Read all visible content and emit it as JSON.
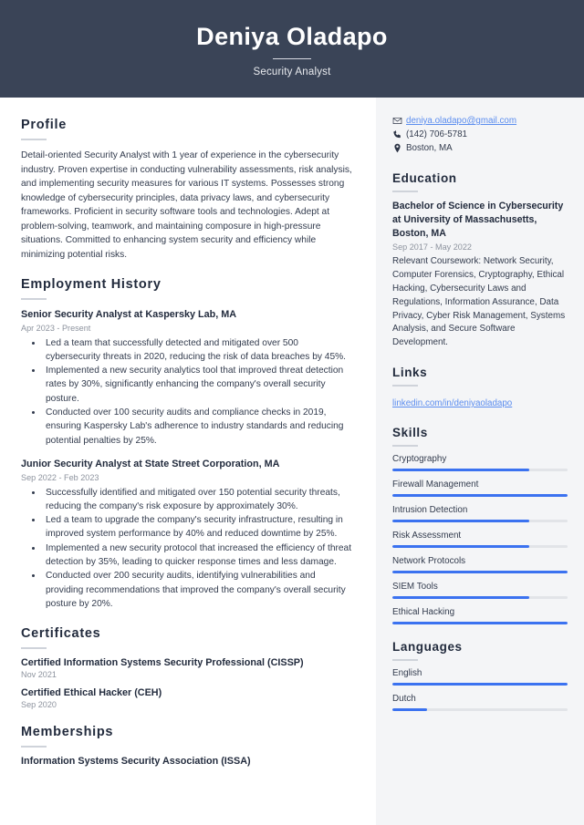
{
  "header": {
    "name": "Deniya Oladapo",
    "subtitle": "Security Analyst"
  },
  "main": {
    "profile": {
      "heading": "Profile",
      "text": "Detail-oriented Security Analyst with 1 year of experience in the cybersecurity industry. Proven expertise in conducting vulnerability assessments, risk analysis, and implementing security measures for various IT systems. Possesses strong knowledge of cybersecurity principles, data privacy laws, and cybersecurity frameworks. Proficient in security software tools and technologies. Adept at problem-solving, teamwork, and maintaining composure in high-pressure situations. Committed to enhancing system security and efficiency while minimizing potential risks."
    },
    "employment": {
      "heading": "Employment History",
      "entries": [
        {
          "title": "Senior Security Analyst at Kaspersky Lab, MA",
          "date": "Apr 2023 - Present",
          "bullets": [
            "Led a team that successfully detected and mitigated over 500 cybersecurity threats in 2020, reducing the risk of data breaches by 45%.",
            "Implemented a new security analytics tool that improved threat detection rates by 30%, significantly enhancing the company's overall security posture.",
            "Conducted over 100 security audits and compliance checks in 2019, ensuring Kaspersky Lab's adherence to industry standards and reducing potential penalties by 25%."
          ]
        },
        {
          "title": "Junior Security Analyst at State Street Corporation, MA",
          "date": "Sep 2022 - Feb 2023",
          "bullets": [
            "Successfully identified and mitigated over 150 potential security threats, reducing the company's risk exposure by approximately 30%.",
            "Led a team to upgrade the company's security infrastructure, resulting in improved system performance by 40% and reduced downtime by 25%.",
            "Implemented a new security protocol that increased the efficiency of threat detection by 35%, leading to quicker response times and less damage.",
            "Conducted over 200 security audits, identifying vulnerabilities and providing recommendations that improved the company's overall security posture by 20%."
          ]
        }
      ]
    },
    "certificates": {
      "heading": "Certificates",
      "items": [
        {
          "title": "Certified Information Systems Security Professional (CISSP)",
          "date": "Nov 2021"
        },
        {
          "title": "Certified Ethical Hacker (CEH)",
          "date": "Sep 2020"
        }
      ]
    },
    "memberships": {
      "heading": "Memberships",
      "items": [
        {
          "title": "Information Systems Security Association (ISSA)"
        }
      ]
    }
  },
  "sidebar": {
    "contact": [
      {
        "icon": "email-icon",
        "value": "deniya.oladapo@gmail.com",
        "link": true
      },
      {
        "icon": "phone-icon",
        "value": "(142) 706-5781",
        "link": false
      },
      {
        "icon": "location-icon",
        "value": "Boston, MA",
        "link": false
      }
    ],
    "education": {
      "heading": "Education",
      "title": "Bachelor of Science in Cybersecurity at University of Massachusetts, Boston, MA",
      "date": "Sep 2017 - May 2022",
      "description": "Relevant Coursework: Network Security, Computer Forensics, Cryptography, Ethical Hacking, Cybersecurity Laws and Regulations, Information Assurance, Data Privacy, Cyber Risk Management, Systems Analysis, and Secure Software Development."
    },
    "links": {
      "heading": "Links",
      "items": [
        {
          "label": "linkedin.com/in/deniyaoladapo"
        }
      ]
    },
    "skills": {
      "heading": "Skills",
      "items": [
        {
          "label": "Cryptography",
          "level": 78
        },
        {
          "label": "Firewall Management",
          "level": 100
        },
        {
          "label": "Intrusion Detection",
          "level": 78
        },
        {
          "label": "Risk Assessment",
          "level": 78
        },
        {
          "label": "Network Protocols",
          "level": 100
        },
        {
          "label": "SIEM Tools",
          "level": 78
        },
        {
          "label": "Ethical Hacking",
          "level": 100
        }
      ]
    },
    "languages": {
      "heading": "Languages",
      "items": [
        {
          "label": "English",
          "level": 100
        },
        {
          "label": "Dutch",
          "level": 20
        }
      ]
    }
  },
  "colors": {
    "header_bg": "#3a4457",
    "sidebar_bg": "#f4f5f7",
    "accent": "#3b72f0",
    "link": "#5b8def",
    "muted_text": "#8d939e"
  }
}
